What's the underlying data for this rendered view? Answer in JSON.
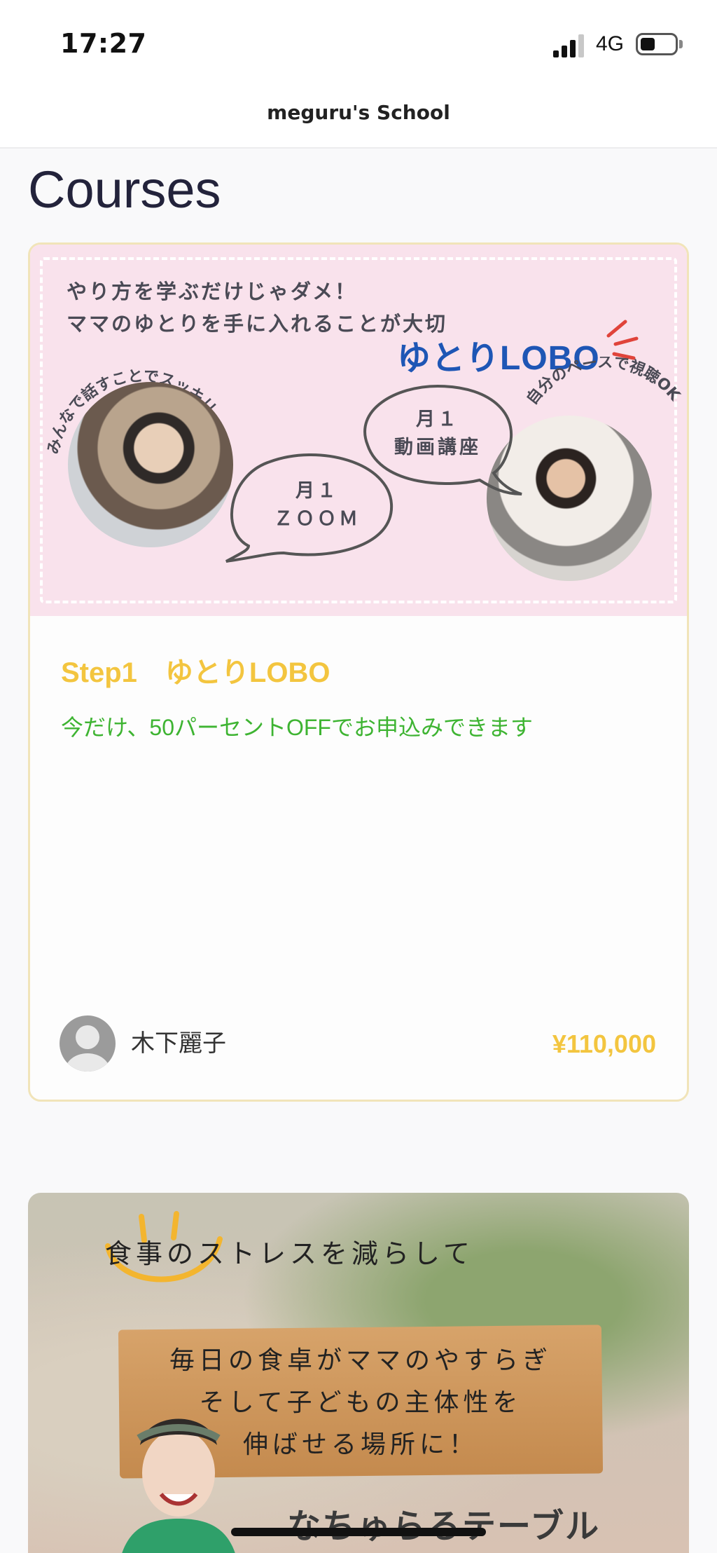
{
  "status": {
    "time": "17:27",
    "network": "4G"
  },
  "nav": {
    "title": "meguru's School"
  },
  "page": {
    "heading": "Courses"
  },
  "course1": {
    "banner": {
      "line1": "やり方を学ぶだけじゃダメ！",
      "line2": "ママのゆとりを手に入れることが大切",
      "logo": "ゆとりLOBO",
      "arc_left": "みんなで話すことでスッキリ納得！",
      "arc_right": "自分のペースで視聴OK",
      "bubble_zoom_1": "月１",
      "bubble_zoom_2": "ＺＯＯＭ",
      "bubble_video_1": "月１",
      "bubble_video_2": "動画講座"
    },
    "title": "Step1　ゆとりLOBO",
    "description": "今だけ、50パーセントOFFでお申込みできます",
    "author": "木下麗子",
    "price": "¥110,000"
  },
  "course2": {
    "banner": {
      "top_line": "食事のストレスを減らして",
      "plank_1": "毎日の食卓がママのやすらぎ",
      "plank_2": "そして子どもの主体性を",
      "plank_3": "伸ばせる場所に！",
      "brand": "なちゅらるテーブル"
    }
  },
  "colors": {
    "accent_yellow": "#f3c53f",
    "accent_green": "#3eb432",
    "card_border": "#f1e4b9",
    "banner_pink": "#f9e2ec",
    "logo_blue": "#1e56b5"
  }
}
